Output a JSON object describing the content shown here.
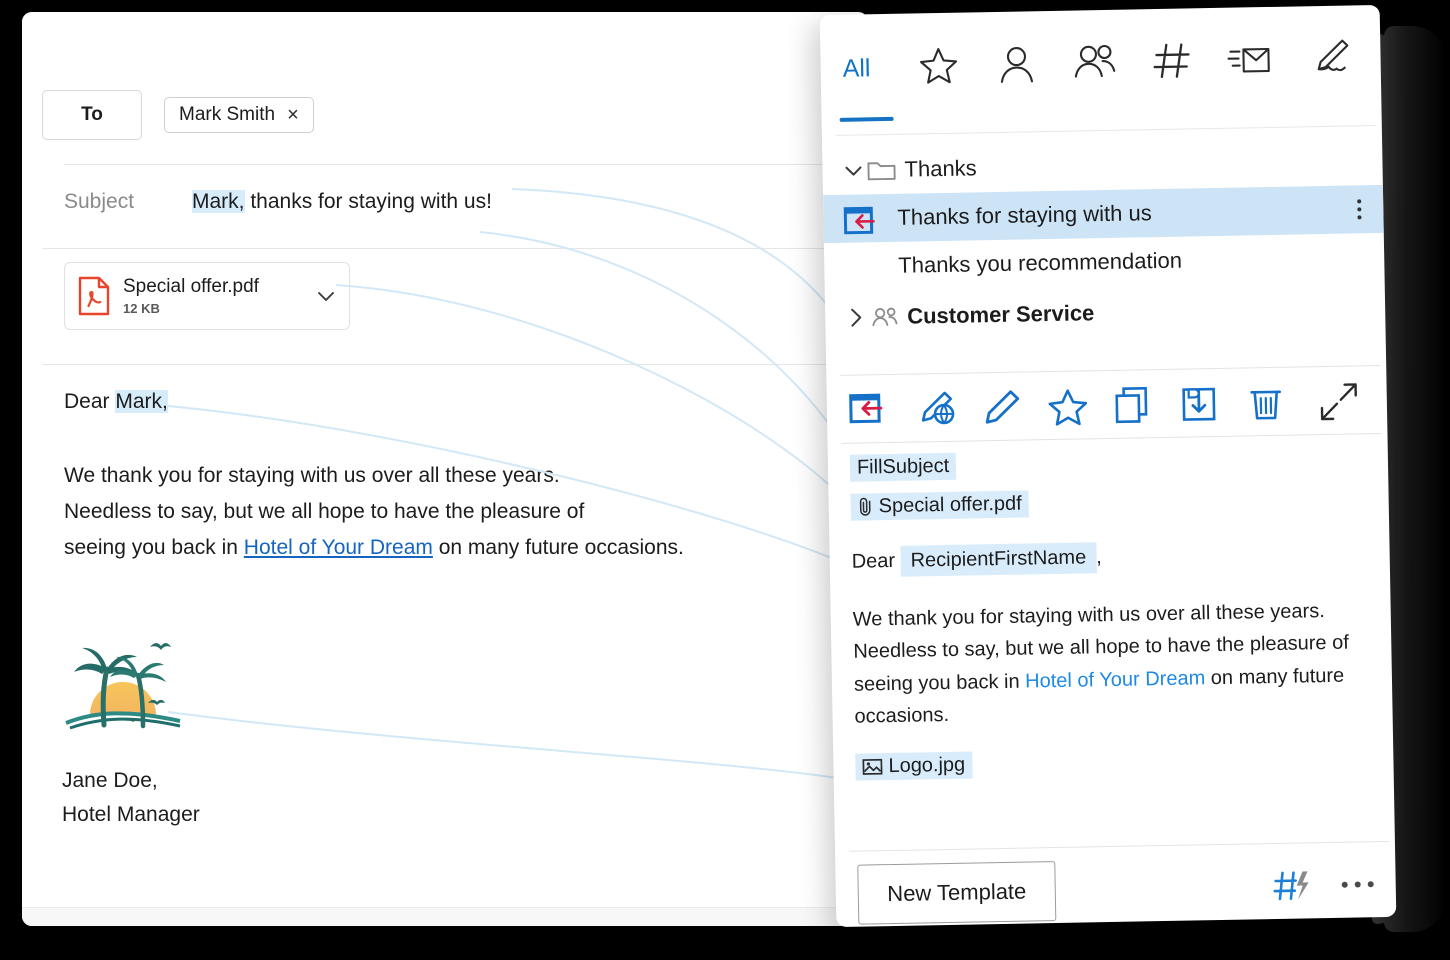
{
  "compose": {
    "to_label": "To",
    "recipient": "Mark Smith",
    "remove_recipient": "×",
    "subject_label": "Subject",
    "subject_token": "Mark,",
    "subject_rest": " thanks for staying with us!",
    "attachment": {
      "name": "Special offer.pdf",
      "size": "12 KB"
    },
    "greeting_prefix": "Dear ",
    "greeting_token": "Mark,",
    "body_line1": "We thank you for staying with us over all these years.",
    "body_line2": "Needless to say, but we all hope to have the pleasure of",
    "body_line3_pre": "seeing you back in ",
    "body_link": "Hotel of Your Dream",
    "body_line3_post": " on many future occasions.",
    "signature_name": "Jane Doe,",
    "signature_title": "Hotel Manager"
  },
  "panel": {
    "tabs": {
      "all_label": "All",
      "icons": [
        "star-icon",
        "person-icon",
        "people-icon",
        "hashtag-icon",
        "quick-mail-icon",
        "signature-pen-icon"
      ]
    },
    "tree": [
      {
        "label": "Thanks",
        "type": "folder",
        "expanded": true,
        "icon": "chevron-down-icon"
      },
      {
        "label": "Thanks for staying with us",
        "type": "template",
        "selected": true,
        "icon": "insert-template-icon"
      },
      {
        "label": "Thanks you recommendation",
        "type": "template",
        "selected": false
      },
      {
        "label": "Customer Service",
        "type": "group",
        "expanded": false,
        "icon": "chevron-right-icon"
      }
    ],
    "toolbar": [
      "insert-template-icon",
      "edit-html-icon",
      "edit-icon",
      "favorite-star-icon",
      "copy-icon",
      "save-to-folder-icon",
      "delete-icon"
    ],
    "toolbar_right": "expand-icon",
    "preview": {
      "subject_token": "FillSubject",
      "attachment_token": "Special offer.pdf",
      "dear_prefix": "Dear",
      "dear_token": "RecipientFirstName",
      "dear_comma": ",",
      "body_pre": "We thank you for staying with us over all these years. Needless to say, but we all hope to have the pleasure of seeing you back in ",
      "body_link": "Hotel of Your Dream",
      "body_post": " on many future occasions.",
      "image_token": "Logo.jpg"
    },
    "footer": {
      "new_template_label": "New Template",
      "hash_bolt_icon": "hash-lightning-icon",
      "more_icon": "more-ellipsis-icon"
    }
  },
  "colors": {
    "accent": "#1573c6",
    "link": "#1e88e5",
    "token_highlight": "#d9ecfb",
    "selection": "#cde4f7",
    "connector": "#d3e8f7",
    "pdf_red": "#e8452c"
  }
}
